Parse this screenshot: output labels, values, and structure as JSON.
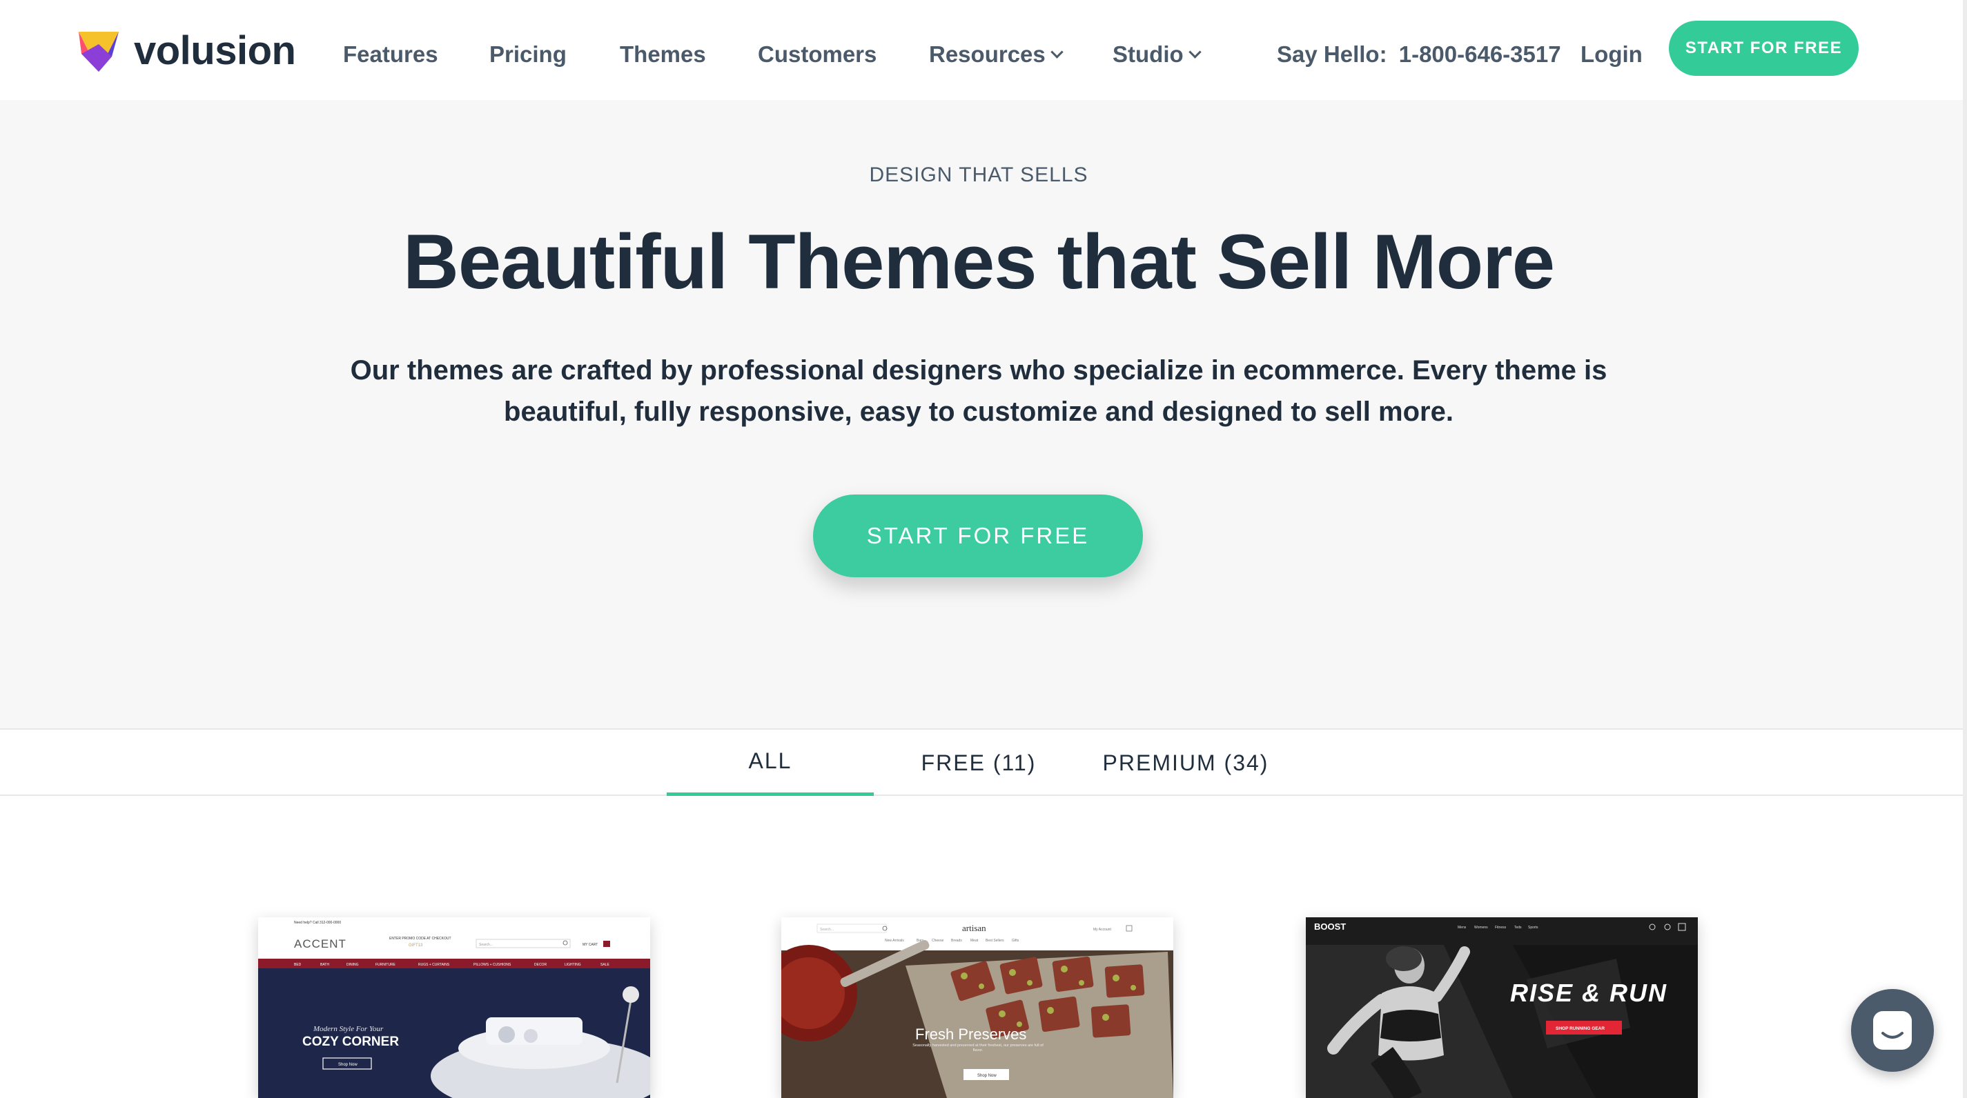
{
  "header": {
    "logo_text": "volusion",
    "nav": [
      {
        "label": "Features",
        "has_dropdown": false
      },
      {
        "label": "Pricing",
        "has_dropdown": false
      },
      {
        "label": "Themes",
        "has_dropdown": false
      },
      {
        "label": "Customers",
        "has_dropdown": false
      },
      {
        "label": "Resources",
        "has_dropdown": true
      },
      {
        "label": "Studio",
        "has_dropdown": true
      }
    ],
    "say_hello": "Say Hello:",
    "phone": "1-800-646-3517",
    "login": "Login",
    "cta": "START FOR FREE"
  },
  "hero": {
    "eyebrow": "DESIGN THAT SELLS",
    "title": "Beautiful Themes that Sell More",
    "description": "Our themes are crafted by professional designers who specialize in ecommerce. Every theme is beautiful, fully responsive, easy to customize and designed to sell more.",
    "cta": "START FOR FREE"
  },
  "tabs": [
    {
      "label": "ALL",
      "active": true
    },
    {
      "label": "FREE (11)",
      "active": false
    },
    {
      "label": "PREMIUM (34)",
      "active": false
    }
  ],
  "themes": [
    {
      "name": "ACCENT",
      "topbar": "Need help? Call 312-000-0000",
      "promo": "ENTER PROMO CODE AT CHECKOUT",
      "promo_code": "GIFT13",
      "search_placeholder": "Search...",
      "cart": "MY CART",
      "menu": [
        "BED",
        "BATH",
        "DINING",
        "FURNITURE",
        "RUGS + CURTAINS",
        "PILLOWS + CUSHIONS",
        "DECOR",
        "LIGHTING",
        "SALE"
      ],
      "tagline": "Modern Style For Your",
      "headline": "COZY CORNER",
      "button": "Shop Now"
    },
    {
      "name": "artisan",
      "search_placeholder": "Search...",
      "account": "My Account",
      "menu": [
        "New Arrivals",
        "Bars",
        "Cheese",
        "Breads",
        "Meat",
        "Best Sellers",
        "Gifts"
      ],
      "headline": "Fresh Preserves",
      "subtext": "Seasonally harvested and preserved at their freshest, our preserves are full of flavor.",
      "button": "Shop Now"
    },
    {
      "name": "BOOST",
      "menu": [
        "Mens",
        "Womens",
        "Fitness",
        "Teds",
        "Sports"
      ],
      "headline": "RISE & RUN",
      "button": "SHOP RUNNING GEAR"
    }
  ],
  "colors": {
    "accent": "#33cc99",
    "text_dark": "#1f2d3d",
    "text_muted": "#4a5a6a",
    "hero_bg": "#f7f7f7",
    "accent_theme_maroon": "#8b1a2b",
    "chat_bubble": "#4b5b6b"
  },
  "icons": [
    "volusion-logo-icon",
    "chevron-down-icon",
    "search-icon",
    "cart-icon",
    "chat-icon"
  ]
}
